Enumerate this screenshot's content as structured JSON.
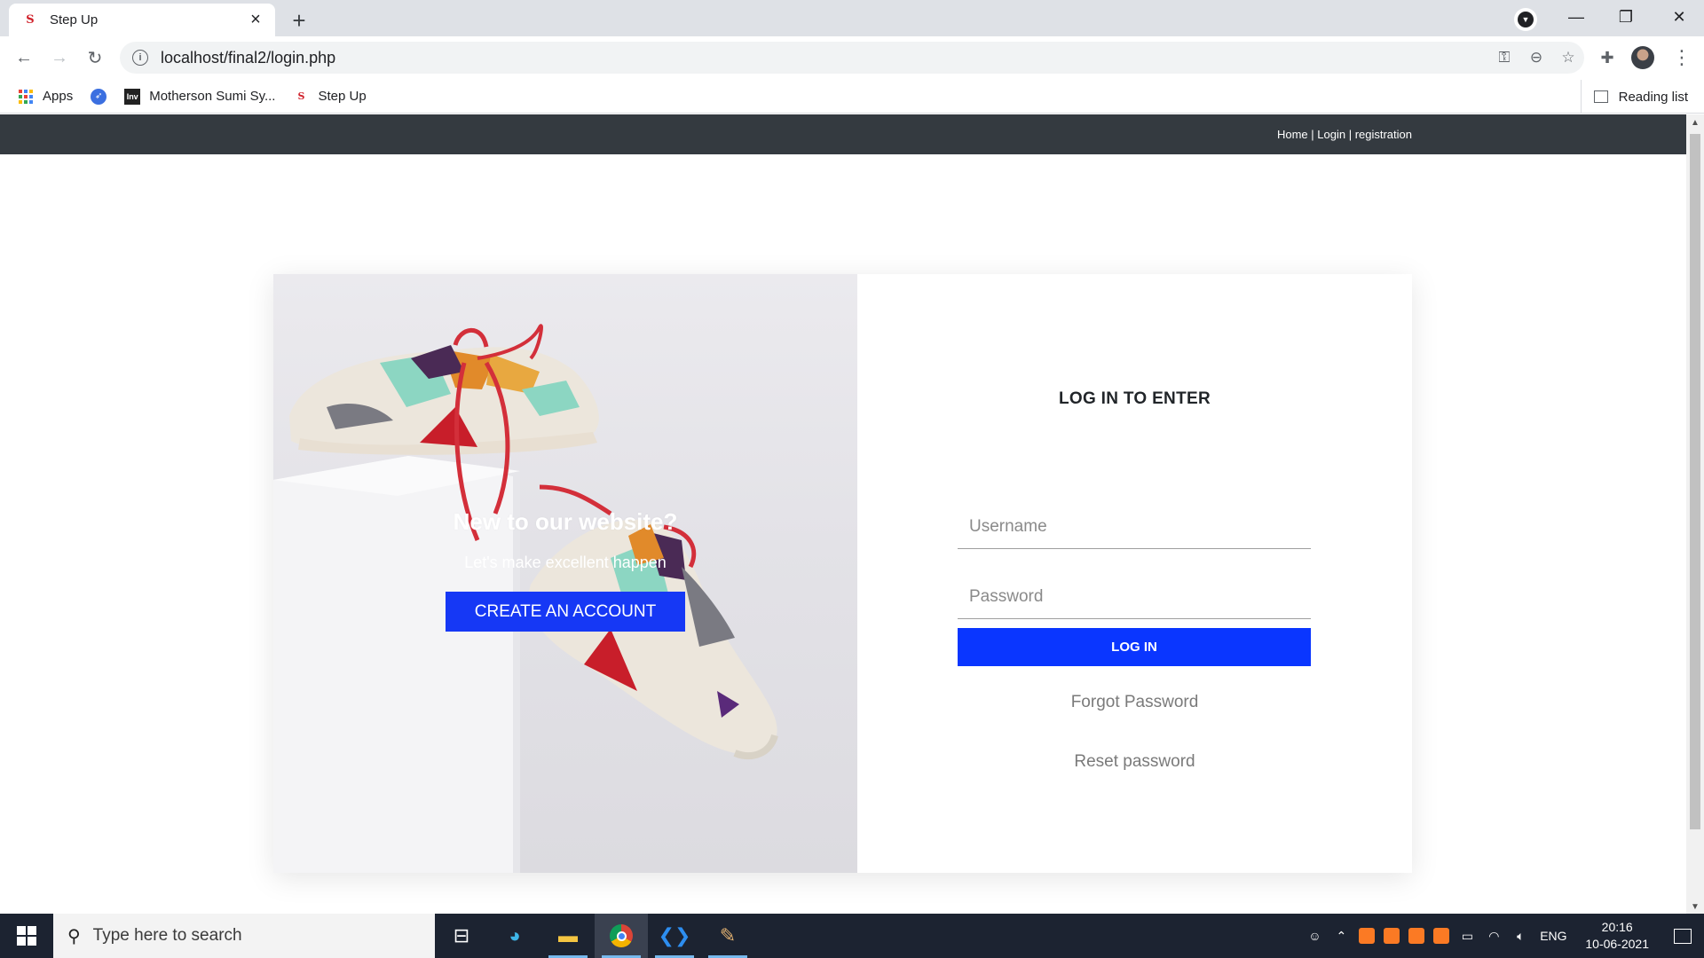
{
  "browser": {
    "tab_title": "Step Up",
    "tab_favicon": "S",
    "url": "localhost/final2/login.php",
    "bookmarks": [
      {
        "label": "Apps",
        "icon": "apps-grid-icon"
      },
      {
        "label": "",
        "icon": "rocket-icon"
      },
      {
        "label": "Motherson Sumi Sy...",
        "icon": "inv-icon"
      },
      {
        "label": "Step Up",
        "icon": "stepup-favicon-icon"
      }
    ],
    "inv_icon_text": "Inv",
    "reading_list": "Reading list"
  },
  "site": {
    "nav_links": [
      "Home",
      "Login",
      "registration"
    ],
    "separator": " | "
  },
  "hero": {
    "title": "New to our website?",
    "subtitle": "Let's make excellent happen",
    "button": "CREATE AN ACCOUNT"
  },
  "login": {
    "title": "LOG IN TO ENTER",
    "username_placeholder": "Username",
    "password_placeholder": "Password",
    "button": "LOG IN",
    "forgot": "Forgot Password",
    "reset": "Reset password"
  },
  "taskbar": {
    "search_placeholder": "Type here to search",
    "language": "ENG",
    "time": "20:16",
    "date": "10-06-2021"
  },
  "colors": {
    "nav_bg": "#343a40",
    "primary_button": "#0a36ff",
    "create_button": "#1638f5",
    "taskbar_bg": "#1c2331"
  }
}
